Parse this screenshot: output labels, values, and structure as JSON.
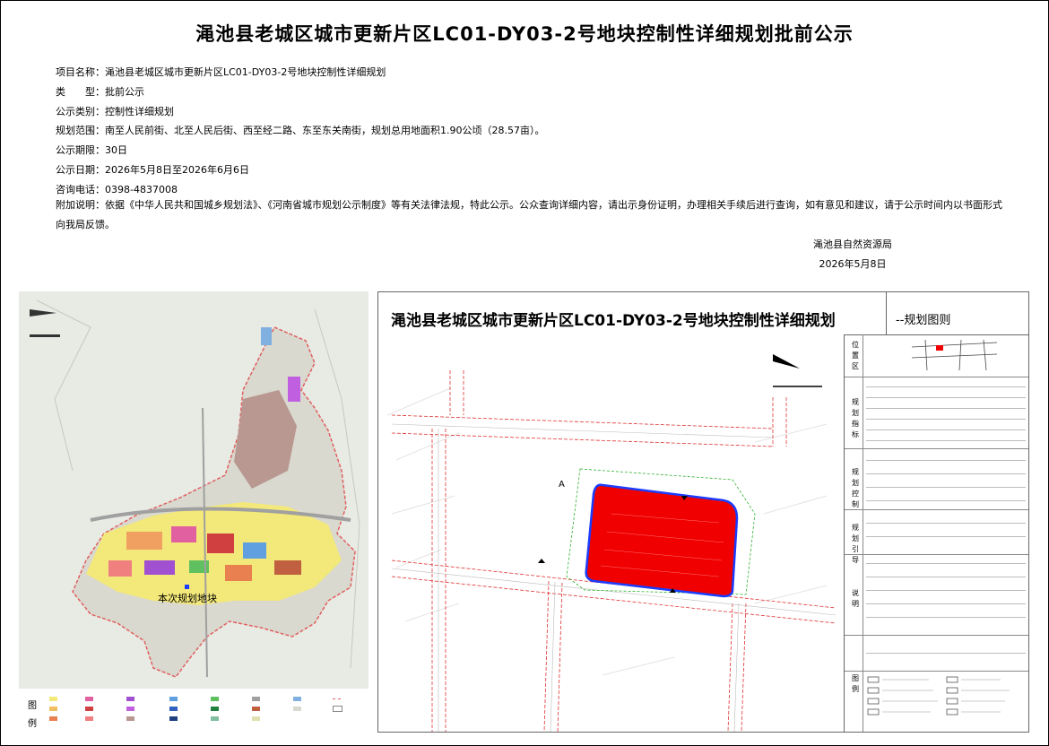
{
  "title": "渑池县老城区城市更新片区LC01-DY03-2号地块控制性详细规划批前公示",
  "info": [
    {
      "label": "项目名称：",
      "value": "渑池县老城区城市更新片区LC01-DY03-2号地块控制性详细规划"
    },
    {
      "label": "类　　型：",
      "value": "批前公示"
    },
    {
      "label": "公示类别：",
      "value": "控制性详细规划"
    },
    {
      "label": "规划范围：",
      "value": "南至人民前街、北至人民后街、西至经二路、东至东关南街，规划总用地面积1.90公顷（28.57亩）。"
    },
    {
      "label": "公示期限：",
      "value": "30日"
    },
    {
      "label": "公示日期：",
      "value": "2026年5月8日至2026年6月6日"
    },
    {
      "label": "咨询电话：",
      "value": "0398-4837008"
    }
  ],
  "notice_label": "附加说明：",
  "notice_text": "依据《中华人民共和国城乡规划法》、《河南省城市规划公示制度》等有关法律法规，特此公示。公众查询详细内容，请出示身份证明，办理相关手续后进行查询，如有意见和建议，请于公示时间内以书面形式向我局反馈。",
  "sign": {
    "org": "渑池县自然资源局",
    "date": "2026年5月8日"
  },
  "left_map": {
    "plot_label": "本次规划地块",
    "legend_title": "图例"
  },
  "drawing": {
    "title": "渑池县老城区城市更新片区LC01-DY03-2号地块控制性详细规划",
    "subtitle": "--规划图则",
    "side_headers": [
      "位置区",
      "规划指标",
      "规划控制",
      "规划引导",
      "说明",
      "图例"
    ],
    "section_mark": "A"
  },
  "colors": {
    "plot_red": "#f00000",
    "plot_border": "#1a3cff",
    "road_dash": "#e03030"
  }
}
